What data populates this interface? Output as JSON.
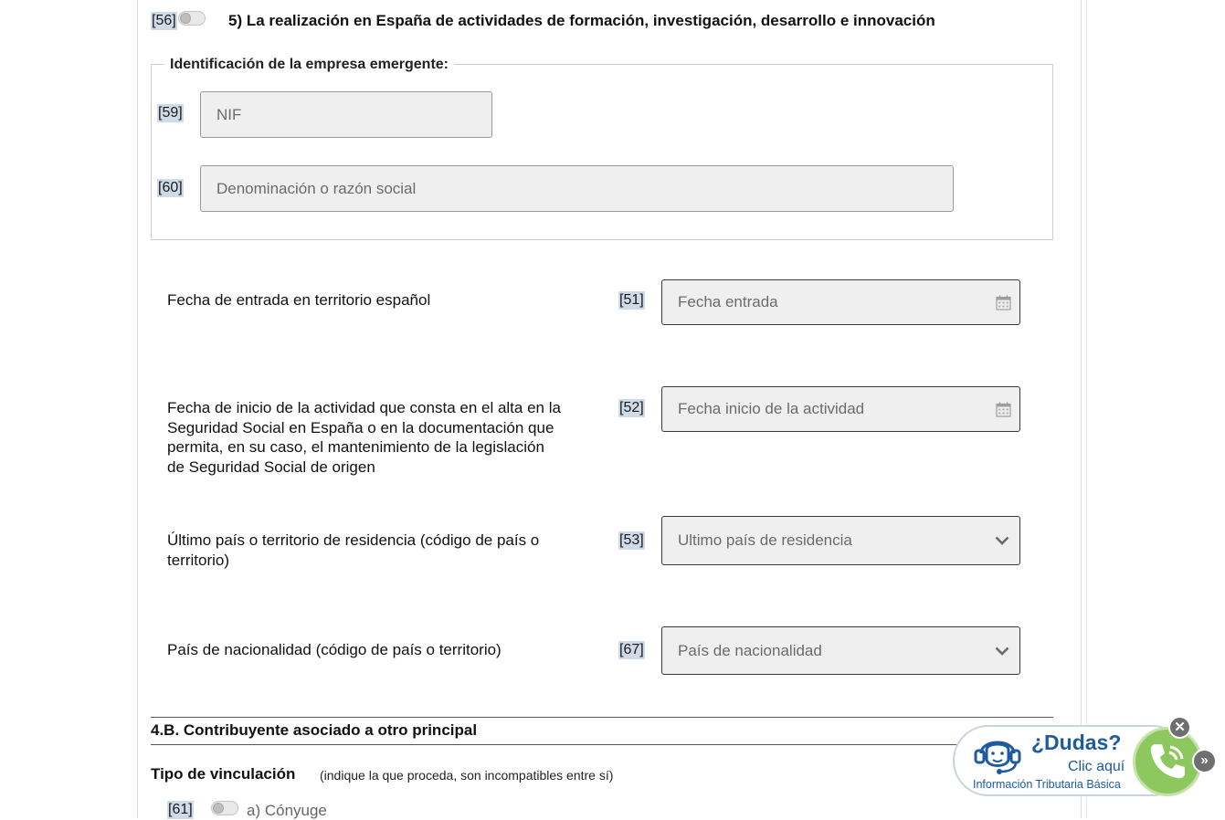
{
  "section5": {
    "code": "[56]",
    "title": "5) La realización en España de actividades de formación, investigación, desarrollo e innovación",
    "toggle_on": false
  },
  "empresa": {
    "legend": "Identificación de la empresa emergente:",
    "nif": {
      "code": "[59]",
      "placeholder": "NIF",
      "value": ""
    },
    "denominacion": {
      "code": "[60]",
      "placeholder": "Denominación o razón social",
      "value": ""
    }
  },
  "fields": {
    "fecha_entrada": {
      "label": "Fecha de entrada en territorio español",
      "code": "[51]",
      "placeholder": "Fecha entrada",
      "icon": "calendar-icon"
    },
    "fecha_inicio": {
      "label_lines": [
        "Fecha de inicio de la actividad que consta en el alta en la",
        "Seguridad Social en España o en la documentación que",
        "permita, en su caso, el mantenimiento de la legislación",
        "de Seguridad Social de origen"
      ],
      "code": "[52]",
      "placeholder": "Fecha inicio de la actividad",
      "icon": "calendar-icon"
    },
    "ultimo_pais": {
      "label_lines": [
        "Último país o territorio de residencia (código de país o",
        "territorio)"
      ],
      "code": "[53]",
      "selected": "Ultimo país de residencia",
      "icon": "chevron-down-icon"
    },
    "nacionalidad": {
      "label": "País de nacionalidad (código de país o territorio)",
      "code": "[67]",
      "selected": "País de nacionalidad",
      "icon": "chevron-down-icon"
    }
  },
  "section4b": {
    "title": "4.B. Contribuyente asociado a otro principal",
    "vinculacion_title": "Tipo de vinculación",
    "vinculacion_note": "(indique la que proceda, son incompatibles entre sí)",
    "option_a": {
      "code": "[61]",
      "label": "a) Cónyuge",
      "toggle_on": false
    }
  },
  "help_widget": {
    "title": "¿Dudas?",
    "link": "Clic aquí",
    "subtitle": "Información Tributaria Básica",
    "close_symbol": "✕",
    "expand_symbol": "»",
    "color": "#1e5aa0",
    "phone_color": "#8dc85f"
  }
}
